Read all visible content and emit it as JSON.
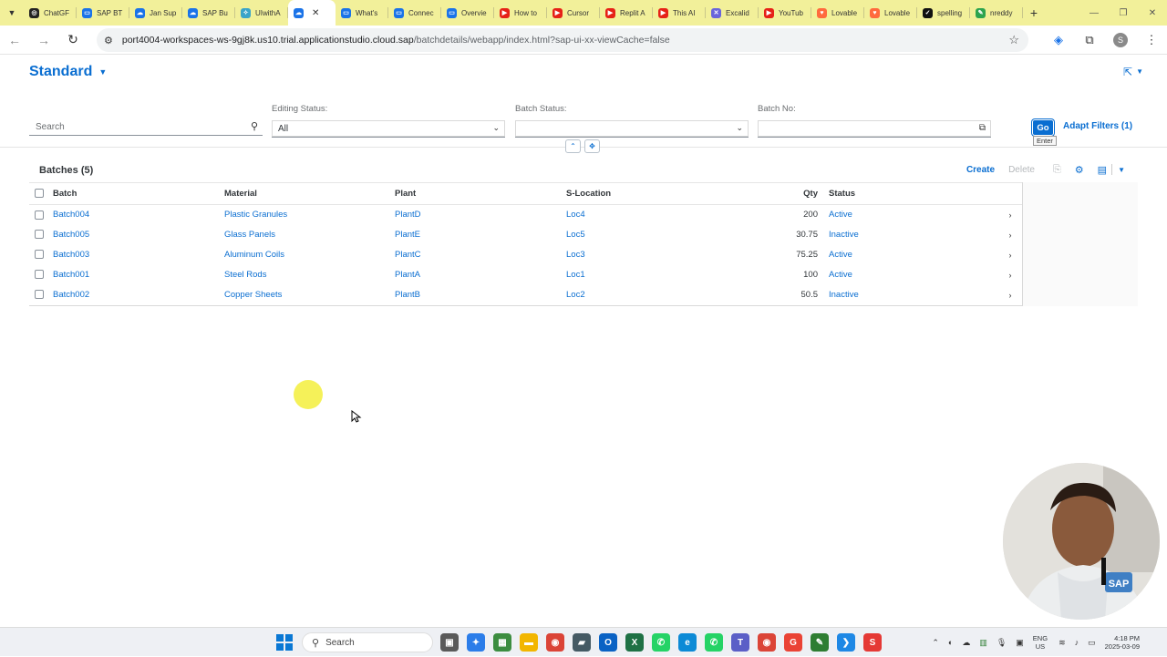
{
  "browser": {
    "tabs": [
      {
        "label": "ChatGF",
        "color": "#222222",
        "glyph": "◎"
      },
      {
        "label": "SAP BT",
        "color": "#1a73e8",
        "glyph": "▭"
      },
      {
        "label": "Jan Sup",
        "color": "#1a73e8",
        "glyph": "☁"
      },
      {
        "label": "SAP Bu",
        "color": "#1a73e8",
        "glyph": "☁"
      },
      {
        "label": "UIwithA",
        "color": "#3aa4c9",
        "glyph": "✧"
      },
      {
        "label": "",
        "color": "#1a73e8",
        "glyph": "☁",
        "active": true
      },
      {
        "label": "What's",
        "color": "#1a73e8",
        "glyph": "▭"
      },
      {
        "label": "Connec",
        "color": "#1a73e8",
        "glyph": "▭"
      },
      {
        "label": "Overvie",
        "color": "#1a73e8",
        "glyph": "▭"
      },
      {
        "label": "How to",
        "color": "#e62117",
        "glyph": "▶"
      },
      {
        "label": "Cursor",
        "color": "#e62117",
        "glyph": "▶"
      },
      {
        "label": "Replit A",
        "color": "#e62117",
        "glyph": "▶"
      },
      {
        "label": "This AI",
        "color": "#e62117",
        "glyph": "▶"
      },
      {
        "label": "Excalid",
        "color": "#6965db",
        "glyph": "✕"
      },
      {
        "label": "YouTub",
        "color": "#e62117",
        "glyph": "▶"
      },
      {
        "label": "Lovable",
        "color": "#ff6a3d",
        "glyph": "♥"
      },
      {
        "label": "Lovable",
        "color": "#ff6a3d",
        "glyph": "♥"
      },
      {
        "label": "spelling",
        "color": "#111111",
        "glyph": "✓"
      },
      {
        "label": "nreddy",
        "color": "#2da44e",
        "glyph": "✎"
      }
    ],
    "url_host": "port4004-workspaces-ws-9gj8k.us10.trial.applicationstudio.cloud.sap",
    "url_path": "/batchdetails/webapp/index.html?sap-ui-xx-viewCache=false",
    "profile_initial": "S"
  },
  "app": {
    "variant_title": "Standard",
    "search_placeholder": "Search",
    "filters": {
      "editing_status_label": "Editing Status:",
      "editing_status_value": "All",
      "batch_status_label": "Batch Status:",
      "batch_status_value": "",
      "batch_no_label": "Batch No:",
      "batch_no_value": ""
    },
    "go_label": "Go",
    "go_tooltip": "Enter",
    "adapt_filters_label": "Adapt Filters (1)",
    "table": {
      "title": "Batches (5)",
      "create_label": "Create",
      "delete_label": "Delete",
      "columns": [
        "Batch",
        "Material",
        "Plant",
        "S-Location",
        "Qty",
        "Status"
      ],
      "rows": [
        {
          "batch": "Batch004",
          "material": "Plastic Granules",
          "plant": "PlantD",
          "sloc": "Loc4",
          "qty": "200",
          "status": "Active"
        },
        {
          "batch": "Batch005",
          "material": "Glass Panels",
          "plant": "PlantE",
          "sloc": "Loc5",
          "qty": "30.75",
          "status": "Inactive"
        },
        {
          "batch": "Batch003",
          "material": "Aluminum Coils",
          "plant": "PlantC",
          "sloc": "Loc3",
          "qty": "75.25",
          "status": "Active"
        },
        {
          "batch": "Batch001",
          "material": "Steel Rods",
          "plant": "PlantA",
          "sloc": "Loc1",
          "qty": "100",
          "status": "Active"
        },
        {
          "batch": "Batch002",
          "material": "Copper Sheets",
          "plant": "PlantB",
          "sloc": "Loc2",
          "qty": "50.5",
          "status": "Inactive"
        }
      ]
    }
  },
  "taskbar": {
    "search_placeholder": "Search",
    "lang_line1": "ENG",
    "lang_line2": "US",
    "time": "4:18 PM",
    "date": "2025-03-09",
    "apps": [
      {
        "name": "task-view",
        "color": "#5a5a5a",
        "glyph": "▣"
      },
      {
        "name": "copilot",
        "color": "#2b7de9",
        "glyph": "✦"
      },
      {
        "name": "calculator",
        "color": "#3c8d40",
        "glyph": "▦"
      },
      {
        "name": "file-explorer",
        "color": "#f2b600",
        "glyph": "▬"
      },
      {
        "name": "chrome",
        "color": "#db4437",
        "glyph": "◉"
      },
      {
        "name": "teams-green",
        "color": "#455a64",
        "glyph": "▰"
      },
      {
        "name": "outlook",
        "color": "#0a62c4",
        "glyph": "O"
      },
      {
        "name": "excel",
        "color": "#1e7145",
        "glyph": "X"
      },
      {
        "name": "whatsapp",
        "color": "#25d366",
        "glyph": "✆"
      },
      {
        "name": "edge",
        "color": "#0c8ad6",
        "glyph": "e"
      },
      {
        "name": "whatsapp-2",
        "color": "#25d366",
        "glyph": "✆"
      },
      {
        "name": "teams",
        "color": "#5b5fc7",
        "glyph": "T"
      },
      {
        "name": "chrome-active",
        "color": "#db4437",
        "glyph": "◉"
      },
      {
        "name": "gmail",
        "color": "#ea4335",
        "glyph": "G"
      },
      {
        "name": "notepad",
        "color": "#2e7d32",
        "glyph": "✎"
      },
      {
        "name": "vscode",
        "color": "#1e88e5",
        "glyph": "❯"
      },
      {
        "name": "sap-app",
        "color": "#e53935",
        "glyph": "S"
      }
    ]
  }
}
